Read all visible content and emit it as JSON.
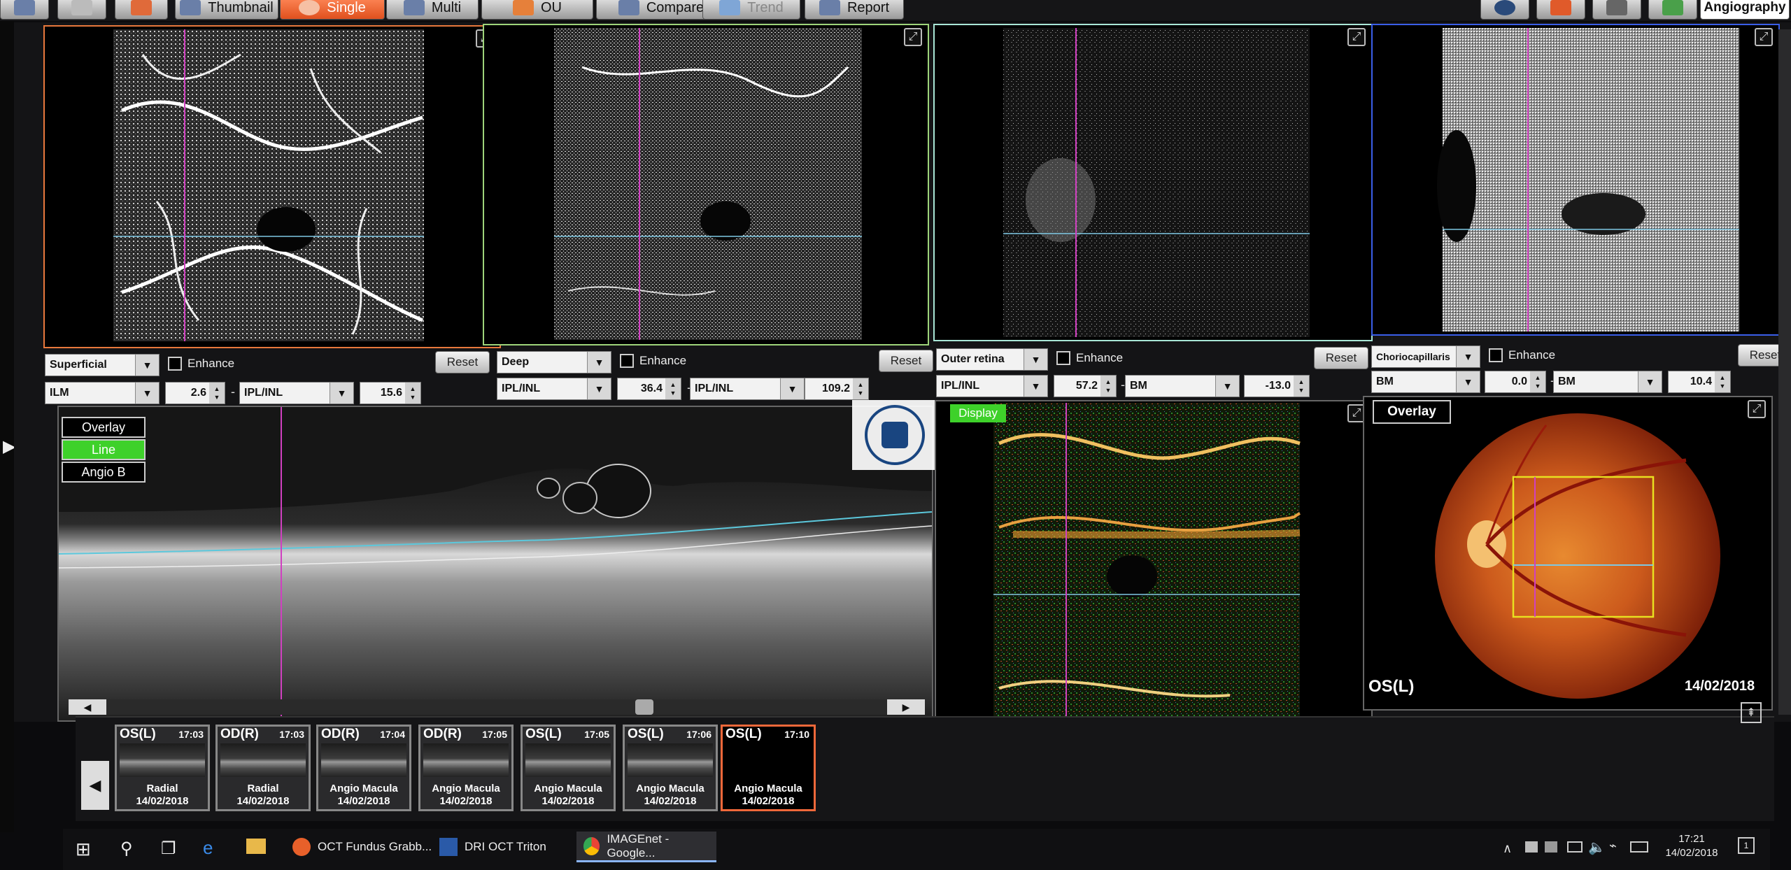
{
  "toolbar": {
    "buttons": [
      {
        "label": "",
        "icon": "save-icon"
      },
      {
        "label": "",
        "icon": "print-icon"
      },
      {
        "label": "",
        "icon": "export-icon"
      },
      {
        "label": "Thumbnail",
        "icon": "thumbnail-icon"
      },
      {
        "label": "Single",
        "icon": "single-view-icon"
      },
      {
        "label": "Multi",
        "icon": "multi-view-icon"
      },
      {
        "label": "OU",
        "icon": "ou-icon"
      },
      {
        "label": "Compare",
        "icon": "compare-icon"
      },
      {
        "label": "Trend",
        "icon": "trend-icon"
      },
      {
        "label": "Report",
        "icon": "report-icon"
      }
    ],
    "mode_label": "Angiography"
  },
  "slabs": [
    {
      "name": "Superficial",
      "enhance": "Enhance",
      "reset": "Reset",
      "top_layer": "ILM",
      "top_offset": "2.6",
      "bottom_layer": "IPL/INL",
      "bottom_offset": "15.6",
      "border": "#e8783c"
    },
    {
      "name": "Deep",
      "enhance": "Enhance",
      "reset": "Reset",
      "top_layer": "IPL/INL",
      "top_offset": "36.4",
      "bottom_layer": "IPL/INL",
      "bottom_offset": "109.2",
      "border": "#9ed47a"
    },
    {
      "name": "Outer retina",
      "enhance": "Enhance",
      "reset": "Reset",
      "top_layer": "IPL/INL",
      "top_offset": "57.2",
      "bottom_layer": "BM",
      "bottom_offset": "-13.0",
      "border": "#a9e6d6"
    },
    {
      "name": "Choriocapillaris",
      "enhance": "Enhance",
      "reset": "Reset",
      "top_layer": "BM",
      "top_offset": "0.0",
      "bottom_layer": "BM",
      "bottom_offset": "10.4",
      "border": "#3a5ee8"
    }
  ],
  "bscan": {
    "modes": [
      "Overlay",
      "Line",
      "Angio B"
    ],
    "active_mode": "Line"
  },
  "display_panel": {
    "label": "Display"
  },
  "fundus": {
    "overlay_label": "Overlay",
    "eye": "OS(L)",
    "date": "14/02/2018"
  },
  "thumbnails": [
    {
      "eye": "OS(L)",
      "time": "17:03",
      "label": "Radial",
      "date": "14/02/2018"
    },
    {
      "eye": "OD(R)",
      "time": "17:03",
      "label": "Radial",
      "date": "14/02/2018"
    },
    {
      "eye": "OD(R)",
      "time": "17:04",
      "label": "Angio Macula",
      "date": "14/02/2018"
    },
    {
      "eye": "OD(R)",
      "time": "17:05",
      "label": "Angio Macula",
      "date": "14/02/2018"
    },
    {
      "eye": "OS(L)",
      "time": "17:05",
      "label": "Angio Macula",
      "date": "14/02/2018"
    },
    {
      "eye": "OS(L)",
      "time": "17:06",
      "label": "Angio Macula",
      "date": "14/02/2018"
    },
    {
      "eye": "OS(L)",
      "time": "17:10",
      "label": "Angio Macula",
      "date": "14/02/2018"
    }
  ],
  "taskbar": {
    "apps": [
      {
        "label": "OCT Fundus Grabb...",
        "icon": "chrome-app-icon"
      },
      {
        "label": "DRI OCT Triton",
        "icon": "topcon-app-icon"
      },
      {
        "label": "IMAGEnet - Google...",
        "icon": "chrome-icon"
      }
    ],
    "clock_time": "17:21",
    "clock_date": "14/02/2018",
    "notifications": "1"
  }
}
